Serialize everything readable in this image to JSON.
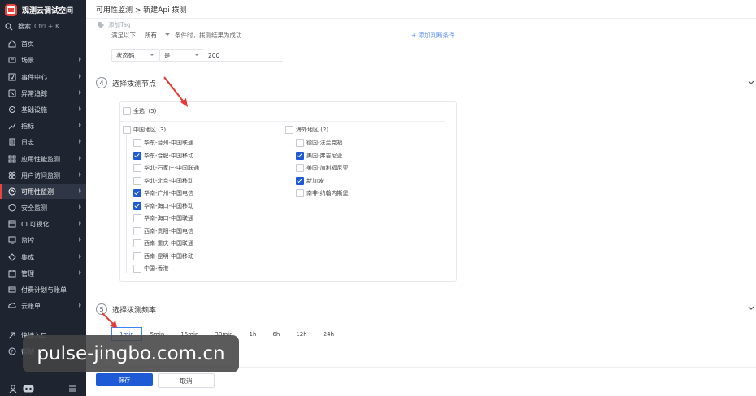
{
  "app": {
    "workspace_name": "观测云调试空间",
    "search_label": "搜索",
    "search_shortcut": "Ctrl + K"
  },
  "sidebar": {
    "items": [
      {
        "label": "首页",
        "icon": "home-icon",
        "has_children": false,
        "active": false
      },
      {
        "label": "场景",
        "icon": "scene-icon",
        "has_children": true,
        "active": false
      },
      {
        "label": "事件中心",
        "icon": "event-icon",
        "has_children": true,
        "active": false
      },
      {
        "label": "异常追踪",
        "icon": "bug-icon",
        "has_children": true,
        "active": false
      },
      {
        "label": "基础设施",
        "icon": "infrastructure-icon",
        "has_children": true,
        "active": false
      },
      {
        "label": "指标",
        "icon": "metrics-icon",
        "has_children": true,
        "active": false
      },
      {
        "label": "日志",
        "icon": "log-icon",
        "has_children": true,
        "active": false
      },
      {
        "label": "应用性能监测",
        "icon": "apm-icon",
        "has_children": true,
        "active": false
      },
      {
        "label": "用户访问监测",
        "icon": "rum-icon",
        "has_children": true,
        "active": false
      },
      {
        "label": "可用性监测",
        "icon": "availability-icon",
        "has_children": true,
        "active": true
      },
      {
        "label": "安全监测",
        "icon": "security-icon",
        "has_children": true,
        "active": false
      },
      {
        "label": "CI 可视化",
        "icon": "ci-icon",
        "has_children": true,
        "active": false
      },
      {
        "label": "监控",
        "icon": "monitor-icon",
        "has_children": true,
        "active": false
      },
      {
        "label": "集成",
        "icon": "integration-icon",
        "has_children": true,
        "active": false
      },
      {
        "label": "管理",
        "icon": "settings-icon",
        "has_children": true,
        "active": false
      },
      {
        "label": "付费计划与账单",
        "icon": "billing-icon",
        "has_children": false,
        "active": false
      },
      {
        "label": "云账单",
        "icon": "cloud-bill-icon",
        "has_children": true,
        "active": false
      },
      {
        "label": "快捷入口",
        "icon": "shortcut-icon",
        "has_children": false,
        "active": false
      },
      {
        "label": "帮助",
        "icon": "help-icon",
        "has_children": false,
        "active": false
      }
    ]
  },
  "header": {
    "breadcrumb": "可用性监测 > 新建Api 拨测"
  },
  "form": {
    "tag_placeholder": "添加Tag",
    "condition_row": {
      "prefix": "满足以下",
      "mode": "所有",
      "suffix": "条件时，拨测结果为成功",
      "add_link": "+ 添加判断条件"
    },
    "assertion": {
      "field": "状态码",
      "operator": "是",
      "value": "200"
    },
    "step4": {
      "number": "4",
      "title": "选择拨测节点",
      "select_all_label": "全选",
      "total_count": "(5)",
      "groups": [
        {
          "name": "中国地区",
          "count": "(3)",
          "nodes": [
            {
              "label": "华东-台州-中国联通",
              "checked": false
            },
            {
              "label": "华东-合肥-中国移动",
              "checked": true
            },
            {
              "label": "华北-石家庄-中国联通",
              "checked": false
            },
            {
              "label": "华北-北京-中国移动",
              "checked": false
            },
            {
              "label": "华南-广州-中国电信",
              "checked": true
            },
            {
              "label": "华南-海口-中国移动",
              "checked": true
            },
            {
              "label": "华南-海口-中国联通",
              "checked": false
            },
            {
              "label": "西南-贵阳-中国电信",
              "checked": false
            },
            {
              "label": "西南-重庆-中国联通",
              "checked": false
            },
            {
              "label": "西南-昆明-中国移动",
              "checked": false
            },
            {
              "label": "中国-香港",
              "checked": false
            }
          ]
        },
        {
          "name": "海外地区",
          "count": "(2)",
          "nodes": [
            {
              "label": "德国-法兰克福",
              "checked": false
            },
            {
              "label": "美国-弗吉尼亚",
              "checked": true
            },
            {
              "label": "美国-加利福尼亚",
              "checked": false
            },
            {
              "label": "新加坡",
              "checked": true
            },
            {
              "label": "南非-约翰内斯堡",
              "checked": false
            }
          ]
        }
      ]
    },
    "step5": {
      "number": "5",
      "title": "选择拨测频率",
      "options": [
        "1min",
        "5min",
        "15min",
        "30min",
        "1h",
        "6h",
        "12h",
        "24h"
      ],
      "selected": "1min"
    },
    "save_label": "保存",
    "cancel_label": "取消"
  },
  "watermark": "pulse-jingbo.com.cn",
  "colors": {
    "sidebar_bg": "#1f2530",
    "accent_red": "#e8453c",
    "primary_blue": "#1f5ad6"
  }
}
